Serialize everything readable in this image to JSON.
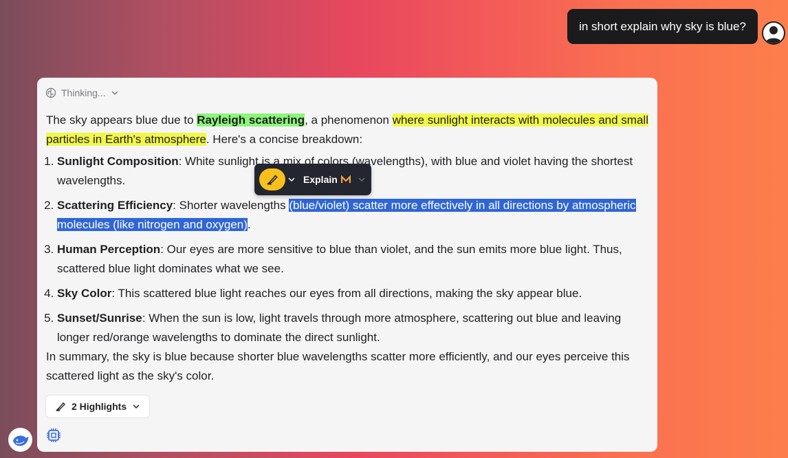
{
  "user_message": "in short explain why sky is blue?",
  "thinking": {
    "label": "Thinking..."
  },
  "answer": {
    "intro_a": "The sky appears blue due to ",
    "intro_hl_green": "Rayleigh scattering",
    "intro_b": ", a phenomenon ",
    "intro_hl_yellow": "where sunlight interacts with molecules and small particles in Earth's atmosphere",
    "intro_c": ". Here's a concise breakdown:",
    "items": [
      {
        "title": "Sunlight Composition",
        "text": ": White sunlight is a mix of colors (wavelengths), with blue and violet having the shortest wavelengths."
      },
      {
        "title": "Scattering Efficiency",
        "text_a": ": Shorter wavelengths ",
        "selected": "(blue/violet) scatter more effectively in all directions by atmospheric molecules (like nitrogen and oxygen)",
        "text_b": "."
      },
      {
        "title": "Human Perception",
        "text": ": Our eyes are more sensitive to blue than violet, and the sun emits more blue light. Thus, scattered blue light dominates what we see."
      },
      {
        "title": "Sky Color",
        "text": ": This scattered blue light reaches our eyes from all directions, making the sky appear blue."
      },
      {
        "title": "Sunset/Sunrise",
        "text": ": When the sun is low, light travels through more atmosphere, scattering out blue and leaving longer red/orange wavelengths to dominate the direct sunlight."
      }
    ],
    "summary": "In summary, the sky is blue because shorter blue wavelengths scatter more efficiently, and our eyes perceive this scattered light as the sky's color."
  },
  "popup": {
    "explain_label": "Explain",
    "highlight_color": "#f8c01c"
  },
  "highlights_button": {
    "label": "2 Highlights"
  },
  "icons": {
    "thinking": "brain-icon",
    "user": "user-avatar-icon",
    "assistant": "whale-logo-icon",
    "highlighter": "highlighter-icon",
    "chip": "cpu-chip-icon"
  }
}
